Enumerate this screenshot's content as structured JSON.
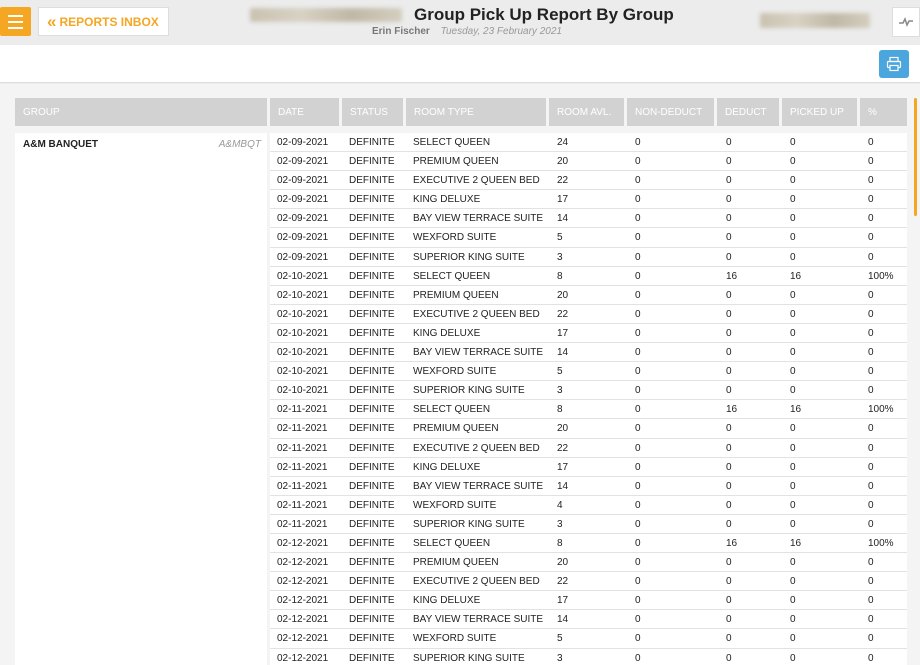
{
  "header": {
    "inbox_label": "REPORTS INBOX",
    "title": "Group Pick Up Report By Group",
    "user": "Erin Fischer",
    "date": "Tuesday, 23 February 2021"
  },
  "table": {
    "columns": [
      "GROUP",
      "DATE",
      "STATUS",
      "ROOM TYPE",
      "ROOM AVL.",
      "NON-DEDUCT",
      "DEDUCT",
      "PICKED UP",
      "%"
    ],
    "group": {
      "name": "A&M BANQUET",
      "code": "A&MBQT"
    },
    "rows": [
      [
        "02-09-2021",
        "DEFINITE",
        "SELECT QUEEN",
        "24",
        "0",
        "0",
        "0",
        "0"
      ],
      [
        "02-09-2021",
        "DEFINITE",
        "PREMIUM QUEEN",
        "20",
        "0",
        "0",
        "0",
        "0"
      ],
      [
        "02-09-2021",
        "DEFINITE",
        "EXECUTIVE 2 QUEEN BED",
        "22",
        "0",
        "0",
        "0",
        "0"
      ],
      [
        "02-09-2021",
        "DEFINITE",
        "KING DELUXE",
        "17",
        "0",
        "0",
        "0",
        "0"
      ],
      [
        "02-09-2021",
        "DEFINITE",
        "BAY VIEW TERRACE SUITE",
        "14",
        "0",
        "0",
        "0",
        "0"
      ],
      [
        "02-09-2021",
        "DEFINITE",
        "WEXFORD SUITE",
        "5",
        "0",
        "0",
        "0",
        "0"
      ],
      [
        "02-09-2021",
        "DEFINITE",
        "SUPERIOR KING SUITE",
        "3",
        "0",
        "0",
        "0",
        "0"
      ],
      [
        "02-10-2021",
        "DEFINITE",
        "SELECT QUEEN",
        "8",
        "0",
        "16",
        "16",
        "100%"
      ],
      [
        "02-10-2021",
        "DEFINITE",
        "PREMIUM QUEEN",
        "20",
        "0",
        "0",
        "0",
        "0"
      ],
      [
        "02-10-2021",
        "DEFINITE",
        "EXECUTIVE 2 QUEEN BED",
        "22",
        "0",
        "0",
        "0",
        "0"
      ],
      [
        "02-10-2021",
        "DEFINITE",
        "KING DELUXE",
        "17",
        "0",
        "0",
        "0",
        "0"
      ],
      [
        "02-10-2021",
        "DEFINITE",
        "BAY VIEW TERRACE SUITE",
        "14",
        "0",
        "0",
        "0",
        "0"
      ],
      [
        "02-10-2021",
        "DEFINITE",
        "WEXFORD SUITE",
        "5",
        "0",
        "0",
        "0",
        "0"
      ],
      [
        "02-10-2021",
        "DEFINITE",
        "SUPERIOR KING SUITE",
        "3",
        "0",
        "0",
        "0",
        "0"
      ],
      [
        "02-11-2021",
        "DEFINITE",
        "SELECT QUEEN",
        "8",
        "0",
        "16",
        "16",
        "100%"
      ],
      [
        "02-11-2021",
        "DEFINITE",
        "PREMIUM QUEEN",
        "20",
        "0",
        "0",
        "0",
        "0"
      ],
      [
        "02-11-2021",
        "DEFINITE",
        "EXECUTIVE 2 QUEEN BED",
        "22",
        "0",
        "0",
        "0",
        "0"
      ],
      [
        "02-11-2021",
        "DEFINITE",
        "KING DELUXE",
        "17",
        "0",
        "0",
        "0",
        "0"
      ],
      [
        "02-11-2021",
        "DEFINITE",
        "BAY VIEW TERRACE SUITE",
        "14",
        "0",
        "0",
        "0",
        "0"
      ],
      [
        "02-11-2021",
        "DEFINITE",
        "WEXFORD SUITE",
        "4",
        "0",
        "0",
        "0",
        "0"
      ],
      [
        "02-11-2021",
        "DEFINITE",
        "SUPERIOR KING SUITE",
        "3",
        "0",
        "0",
        "0",
        "0"
      ],
      [
        "02-12-2021",
        "DEFINITE",
        "SELECT QUEEN",
        "8",
        "0",
        "16",
        "16",
        "100%"
      ],
      [
        "02-12-2021",
        "DEFINITE",
        "PREMIUM QUEEN",
        "20",
        "0",
        "0",
        "0",
        "0"
      ],
      [
        "02-12-2021",
        "DEFINITE",
        "EXECUTIVE 2 QUEEN BED",
        "22",
        "0",
        "0",
        "0",
        "0"
      ],
      [
        "02-12-2021",
        "DEFINITE",
        "KING DELUXE",
        "17",
        "0",
        "0",
        "0",
        "0"
      ],
      [
        "02-12-2021",
        "DEFINITE",
        "BAY VIEW TERRACE SUITE",
        "14",
        "0",
        "0",
        "0",
        "0"
      ],
      [
        "02-12-2021",
        "DEFINITE",
        "WEXFORD SUITE",
        "5",
        "0",
        "0",
        "0",
        "0"
      ],
      [
        "02-12-2021",
        "DEFINITE",
        "SUPERIOR KING SUITE",
        "3",
        "0",
        "0",
        "0",
        "0"
      ]
    ]
  },
  "colors": {
    "accent": "#f5a623",
    "print_button": "#4aa6dc",
    "header_bg": "#d2d2d2"
  },
  "icons": {
    "menu": "hamburger-icon",
    "back": "double-chevron-left-icon",
    "activity": "activity-icon",
    "print": "printer-icon"
  }
}
